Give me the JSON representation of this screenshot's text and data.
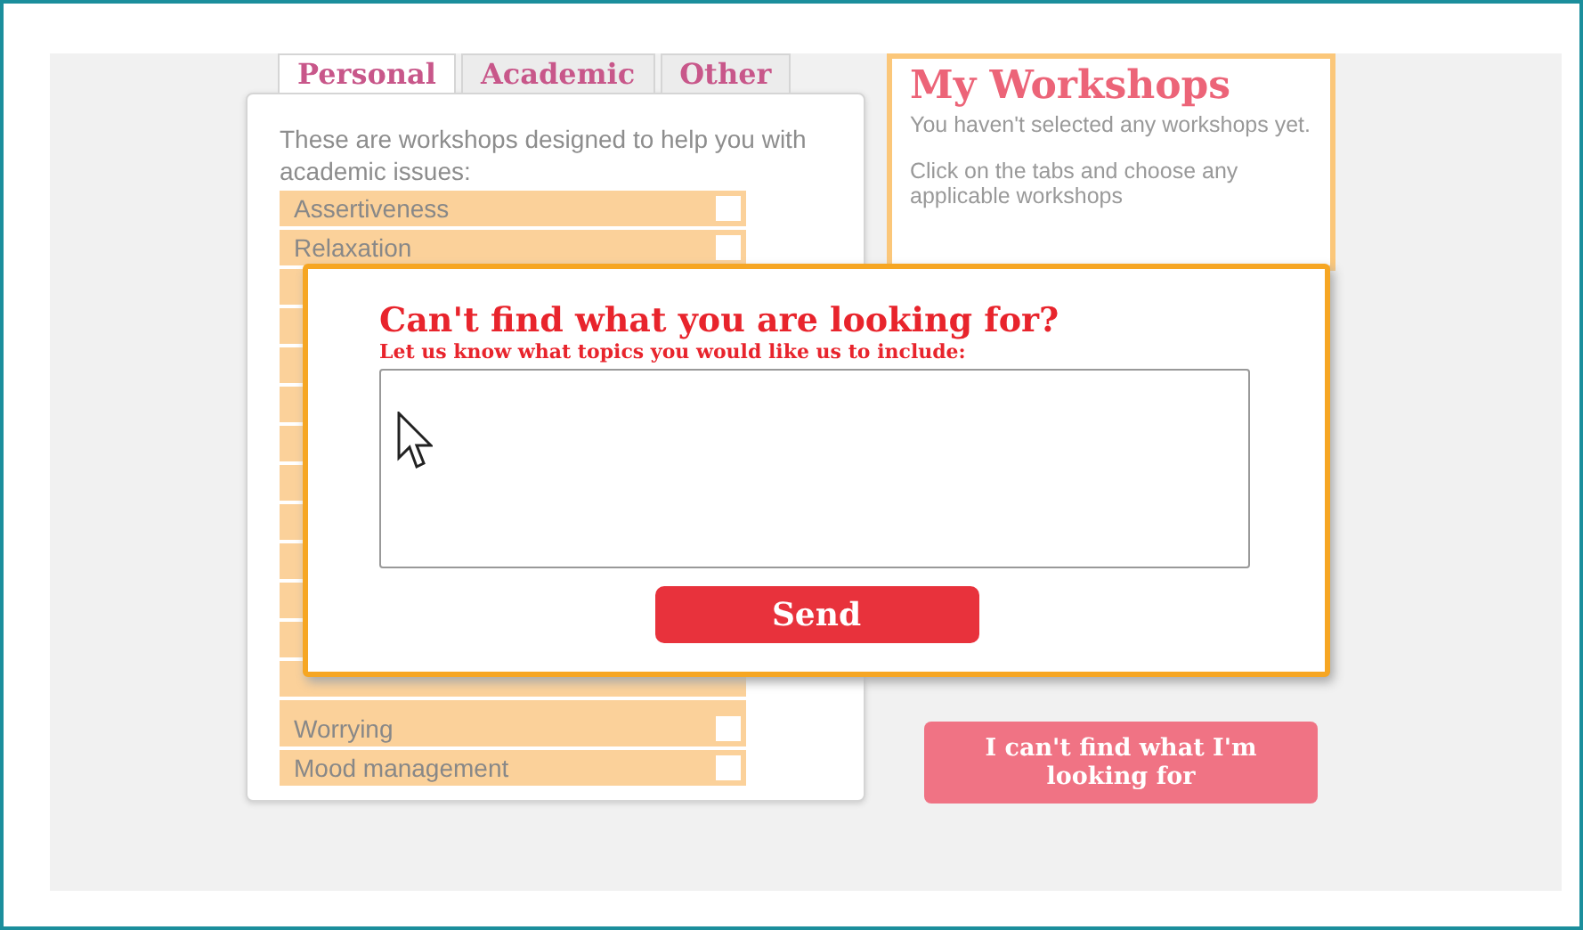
{
  "tabs": [
    {
      "label": "Personal",
      "selected": true
    },
    {
      "label": "Academic",
      "selected": false
    },
    {
      "label": "Other",
      "selected": false
    }
  ],
  "intro": "These are workshops designed to help you with academic issues:",
  "workshops_top": [
    {
      "label": "Assertiveness",
      "checked": false
    },
    {
      "label": "Relaxation",
      "checked": false
    }
  ],
  "workshops_bottom": [
    {
      "label": "Worrying",
      "checked": false
    },
    {
      "label": "Mood management",
      "checked": false
    }
  ],
  "my_workshops": {
    "title": "My Workshops",
    "paragraphs": [
      "You haven't selected any workshops yet.",
      "Click on the tabs and choose any applicable workshops"
    ]
  },
  "cant_find_button": "I can't find what I'm looking for",
  "dialog": {
    "title": "Can't find what you are looking for?",
    "subtitle": "Let us know what topics you would like us to include:",
    "button": "Send"
  }
}
